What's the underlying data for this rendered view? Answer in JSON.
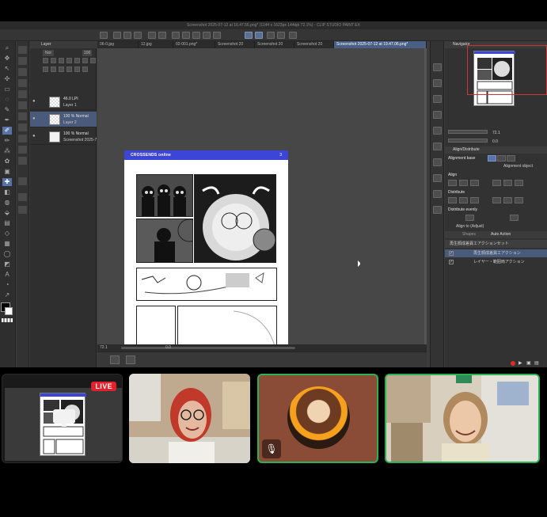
{
  "app": {
    "window_title": "Screenshot 2025-07-12 at 16.47.56.png* (1144 x 1623px 144dpi 72.1%) - CLIP STUDIO PAINT EX",
    "tabs": [
      "06-0.jpg",
      "12.jpg",
      "02-001.png*",
      "Screenshot 20",
      "Screenshot 20",
      "Screenshot 20",
      "Screenshot 2025-07-12 at 19.47.06.png*"
    ],
    "active_tab_index": 6
  },
  "layer_panel": {
    "title": "Layer",
    "blend_mode": "Nor",
    "opacity": "100",
    "layers": [
      {
        "line1": "46.0 LPI",
        "line2": "Layer 1",
        "thumb": "check",
        "selected": false
      },
      {
        "line1": "100 % Normal",
        "line2": "Layer 2",
        "thumb": "check",
        "selected": true
      },
      {
        "line1": "100 % Normal",
        "line2": "Screenshot 2025-7",
        "thumb": "page",
        "selected": false
      }
    ]
  },
  "canvas": {
    "page_brand": "CROSSENDS online",
    "page_number": "3"
  },
  "status": {
    "zoom": "72.1",
    "position": "0.0"
  },
  "navigator": {
    "title": "Navigator",
    "zoom_value": "72.1",
    "rotation_value": "0.0"
  },
  "align_panel": {
    "title": "Align/Distribute",
    "alignment_base_label": "Alignment base",
    "alignment_object_label": "Alignment object",
    "align_label": "Align",
    "distribute_label": "Distribute",
    "distribute_evenly_label": "Distribute evenly",
    "align_to_label": "Align to (Adjust)"
  },
  "auto_action": {
    "tab_other": "Shapes",
    "tab_active": "Auto Action",
    "set_name": "再生顔成差異エアクションセット",
    "actions": [
      {
        "label": "再生顔成差異エアクション",
        "selected": true
      },
      {
        "label": "レイヤー・範囲両アクション",
        "selected": false
      }
    ]
  },
  "participants": {
    "screen_share_badge": "LIVE",
    "colors": {
      "speaking_border": "#2bb257",
      "live": "#e4202b"
    }
  }
}
